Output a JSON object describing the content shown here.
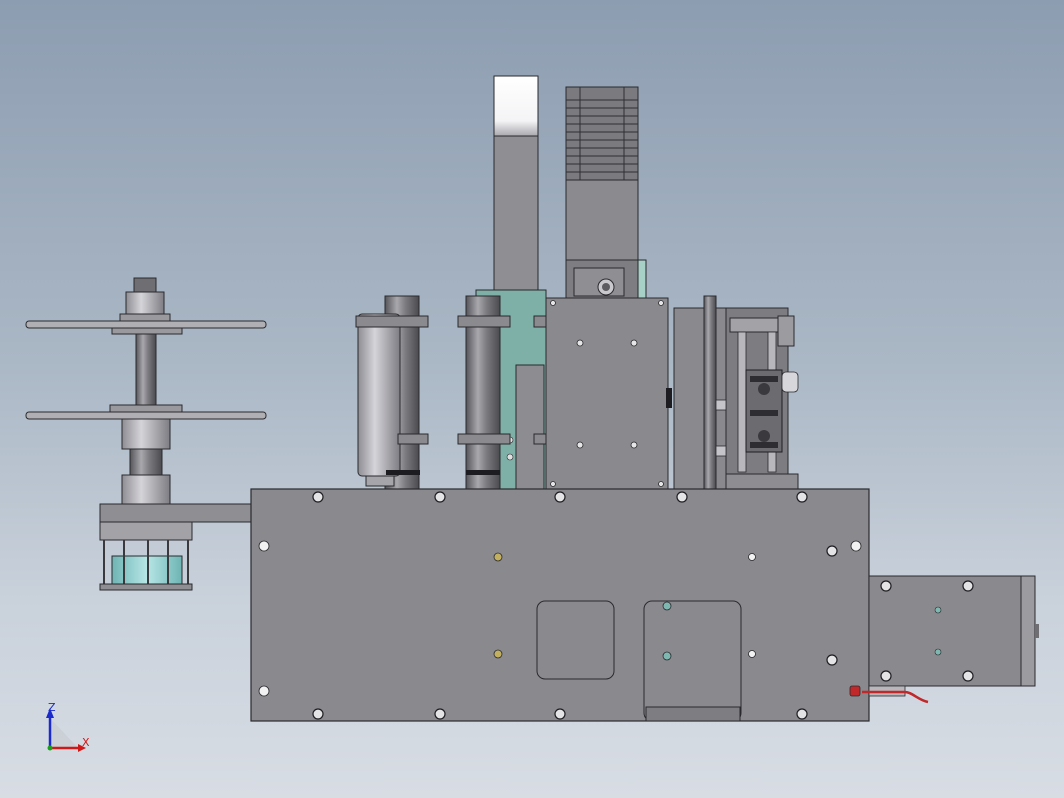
{
  "viewport": {
    "background_top": "#8d9db1",
    "background_bottom": "#d8dde4"
  },
  "model": {
    "body_color": "#8a898d",
    "edge_color": "#2a2a2e",
    "teal_plate_color": "#7fb0a8",
    "glass_color": "#9fd6d6",
    "motor_color": "#7a797c",
    "wire_color": "#c0282a"
  },
  "triad": {
    "z_label": "Z",
    "x_label": "X",
    "z_color": "#1a2acc",
    "x_color": "#d01818",
    "origin_color": "#18a018"
  }
}
